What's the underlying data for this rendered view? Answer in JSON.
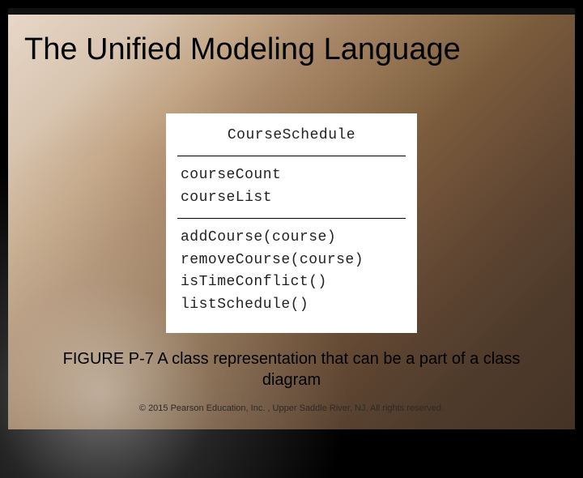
{
  "title": "The Unified Modeling Language",
  "uml": {
    "className": "CourseSchedule",
    "attributes": [
      "courseCount",
      "courseList"
    ],
    "operations": [
      "addCourse(course)",
      "removeCourse(course)",
      "isTimeConflict()",
      "listSchedule()"
    ]
  },
  "caption": "FIGURE P-7 A class representation that can be a part of a class diagram",
  "copyright": "© 2015 Pearson Education, Inc. , Upper Saddle River, NJ.  All rights reserved."
}
